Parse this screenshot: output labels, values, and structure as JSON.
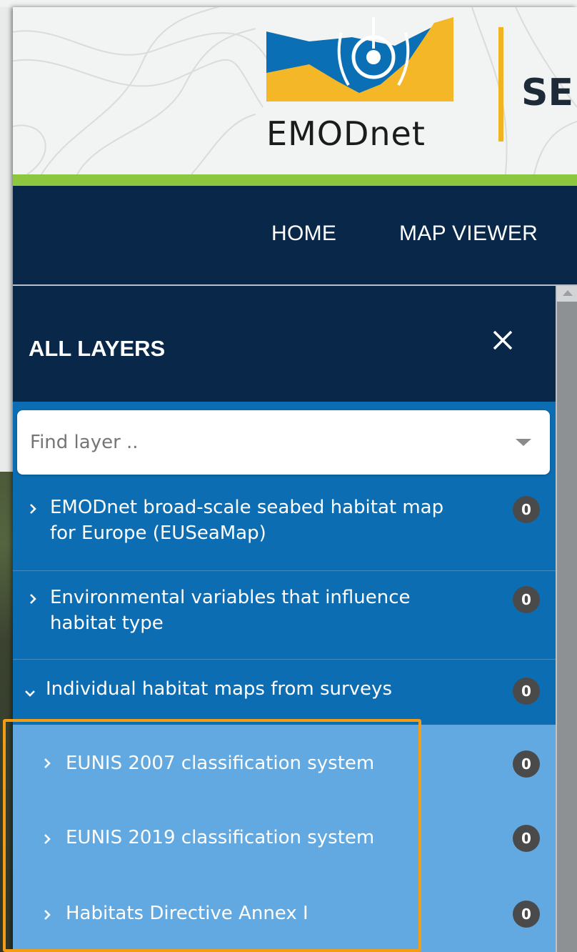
{
  "brand": {
    "logo_text": "EMODnet",
    "site_title_partial": "SE"
  },
  "colors": {
    "nav_bg": "#082749",
    "panel_bg": "#0c6db2",
    "subitem_bg": "#61a9e0",
    "accent_green": "#8dc63f",
    "accent_orange": "#f29d14",
    "badge_bg": "#4a4a4a"
  },
  "nav": {
    "items": [
      {
        "label": "HOME"
      },
      {
        "label": "MAP VIEWER"
      }
    ]
  },
  "panel": {
    "title": "ALL LAYERS",
    "close_icon": "close-icon",
    "search": {
      "placeholder": "Find layer ..",
      "value": ""
    },
    "groups": [
      {
        "line1": "EMODnet broad-scale seabed habitat map",
        "line2": "for Europe (EUSeaMap)",
        "count": "0",
        "expanded": false
      },
      {
        "line1": "Environmental variables that influence",
        "line2": "habitat type",
        "count": "0",
        "expanded": false
      },
      {
        "line1": "Individual habitat maps from surveys",
        "count": "0",
        "expanded": true
      }
    ],
    "subgroups": [
      {
        "label": "EUNIS 2007 classification system",
        "count": "0"
      },
      {
        "label": "EUNIS 2019 classification system",
        "count": "0"
      },
      {
        "label": "Habitats Directive Annex I",
        "count": "0"
      }
    ]
  }
}
